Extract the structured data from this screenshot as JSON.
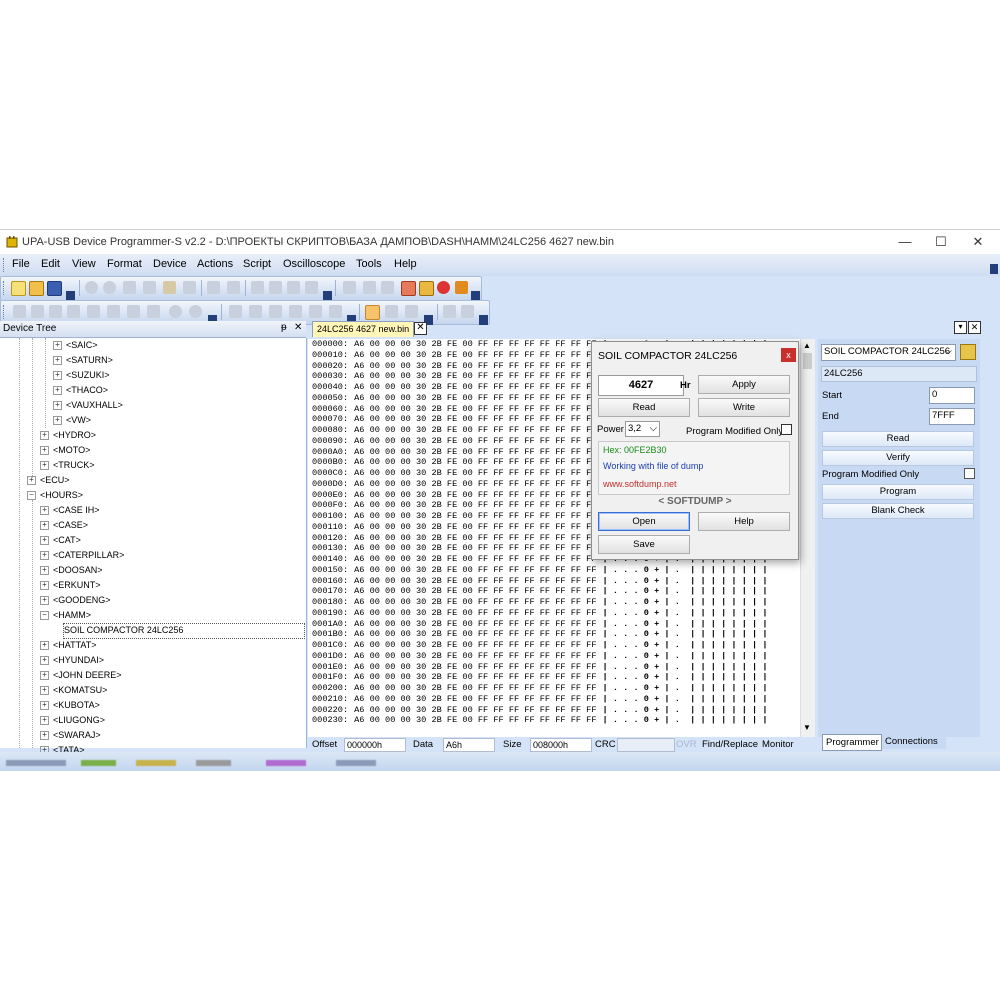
{
  "window": {
    "title": "UPA-USB Device Programmer-S v2.2 - D:\\ПРОЕКТЫ СКРИПТОВ\\БАЗА ДАМПОВ\\DASH\\HAMM\\24LC256 4627 new.bin",
    "controls": {
      "minimize": "—",
      "maximize": "☐",
      "close": "✕"
    }
  },
  "menu": [
    "File",
    "Edit",
    "View",
    "Format",
    "Device",
    "Actions",
    "Script",
    "Oscilloscope",
    "Tools",
    "Help"
  ],
  "device_tree": {
    "header": "Device Tree",
    "pin": "ᵽ",
    "close": "✕",
    "nodes": [
      {
        "label": "<SAIC>",
        "sign": "+",
        "level": 3
      },
      {
        "label": "<SATURN>",
        "sign": "+",
        "level": 3
      },
      {
        "label": "<SUZUKI>",
        "sign": "+",
        "level": 3
      },
      {
        "label": "<THACO>",
        "sign": "+",
        "level": 3
      },
      {
        "label": "<VAUXHALL>",
        "sign": "+",
        "level": 3
      },
      {
        "label": "<VW>",
        "sign": "+",
        "level": 3
      },
      {
        "label": "<HYDRO>",
        "sign": "+",
        "level": 2
      },
      {
        "label": "<MOTO>",
        "sign": "+",
        "level": 2
      },
      {
        "label": "<TRUCK>",
        "sign": "+",
        "level": 2
      },
      {
        "label": "<ECU>",
        "sign": "+",
        "level": 1
      },
      {
        "label": "<HOURS>",
        "sign": "−",
        "level": 1
      },
      {
        "label": "<CASE IH>",
        "sign": "+",
        "level": 2
      },
      {
        "label": "<CASE>",
        "sign": "+",
        "level": 2
      },
      {
        "label": "<CAT>",
        "sign": "+",
        "level": 2
      },
      {
        "label": "<CATERPILLAR>",
        "sign": "+",
        "level": 2
      },
      {
        "label": "<DOOSAN>",
        "sign": "+",
        "level": 2
      },
      {
        "label": "<ERKUNT>",
        "sign": "+",
        "level": 2
      },
      {
        "label": "<GOODENG>",
        "sign": "+",
        "level": 2
      },
      {
        "label": "<HAMM>",
        "sign": "−",
        "level": 2
      },
      {
        "label": "SOIL COMPACTOR 24LC256",
        "sign": "",
        "level": 3
      },
      {
        "label": "<HATTAT>",
        "sign": "+",
        "level": 2
      },
      {
        "label": "<HYUNDAI>",
        "sign": "+",
        "level": 2
      },
      {
        "label": "<JOHN DEERE>",
        "sign": "+",
        "level": 2
      },
      {
        "label": "<KOMATSU>",
        "sign": "+",
        "level": 2
      },
      {
        "label": "<KUBOTA>",
        "sign": "+",
        "level": 2
      },
      {
        "label": "<LIUGONG>",
        "sign": "+",
        "level": 2
      },
      {
        "label": "<SWARAJ>",
        "sign": "+",
        "level": 2
      },
      {
        "label": "<TATA>",
        "sign": "+",
        "level": 2
      }
    ]
  },
  "document_tab": {
    "label": "24LC256 4627 new.bin",
    "close": "✕"
  },
  "hex": {
    "offsets": [
      "000000:",
      "000010:",
      "000020:",
      "000030:",
      "000040:",
      "000050:",
      "000060:",
      "000070:",
      "000080:",
      "000090:",
      "0000A0:",
      "0000B0:",
      "0000C0:",
      "0000D0:",
      "0000E0:",
      "0000F0:",
      "000100:",
      "000110:",
      "000120:",
      "000130:",
      "000140:",
      "000150:",
      "000160:",
      "000170:",
      "000180:",
      "000190:",
      "0001A0:",
      "0001B0:",
      "0001C0:",
      "0001D0:",
      "0001E0:",
      "0001F0:",
      "000200:",
      "000210:",
      "000220:",
      "000230:"
    ],
    "bytes": "A6 00 00 00 30 2B FE 00 FF FF FF FF FF FF FF FF",
    "ascii": "| . . . 0 + | .  | | | | | | | |"
  },
  "statusbar": {
    "offset_label": "Offset",
    "offset_value": "000000h",
    "data_label": "Data",
    "data_value": "A6h",
    "size_label": "Size",
    "size_value": "008000h",
    "crc_label": "CRC",
    "crc_value": "",
    "ovr": "OVR",
    "find_replace": "Find/Replace",
    "monitor": "Monitor"
  },
  "right_panel": {
    "device_select": "SOIL COMPACTOR 24LC256",
    "chip": "24LC256",
    "start_label": "Start",
    "start_value": "0",
    "end_label": "End",
    "end_value": "7FFF",
    "read": "Read",
    "verify": "Verify",
    "program_modified_only": "Program Modified Only",
    "program": "Program",
    "blank_check": "Blank Check",
    "tabs": [
      "Programmer",
      "Connections"
    ]
  },
  "dialog": {
    "title": "SOIL COMPACTOR 24LC256",
    "close": "x",
    "hours_value": "4627",
    "hours_unit": "Hr",
    "apply": "Apply",
    "read": "Read",
    "write": "Write",
    "power_label": "Power",
    "power_value": "3,2",
    "program_modified_only": "Program Modified Only",
    "hex_info": "Hex: 00FE2B30",
    "working_info": "Working with file of dump",
    "site": "www.softdump.net",
    "brand": "< SOFTDUMP >",
    "open": "Open",
    "help": "Help",
    "save": "Save",
    "colors": {
      "hex": "#1a8a1a",
      "working": "#1a3fb0",
      "site": "#c0302a"
    }
  }
}
